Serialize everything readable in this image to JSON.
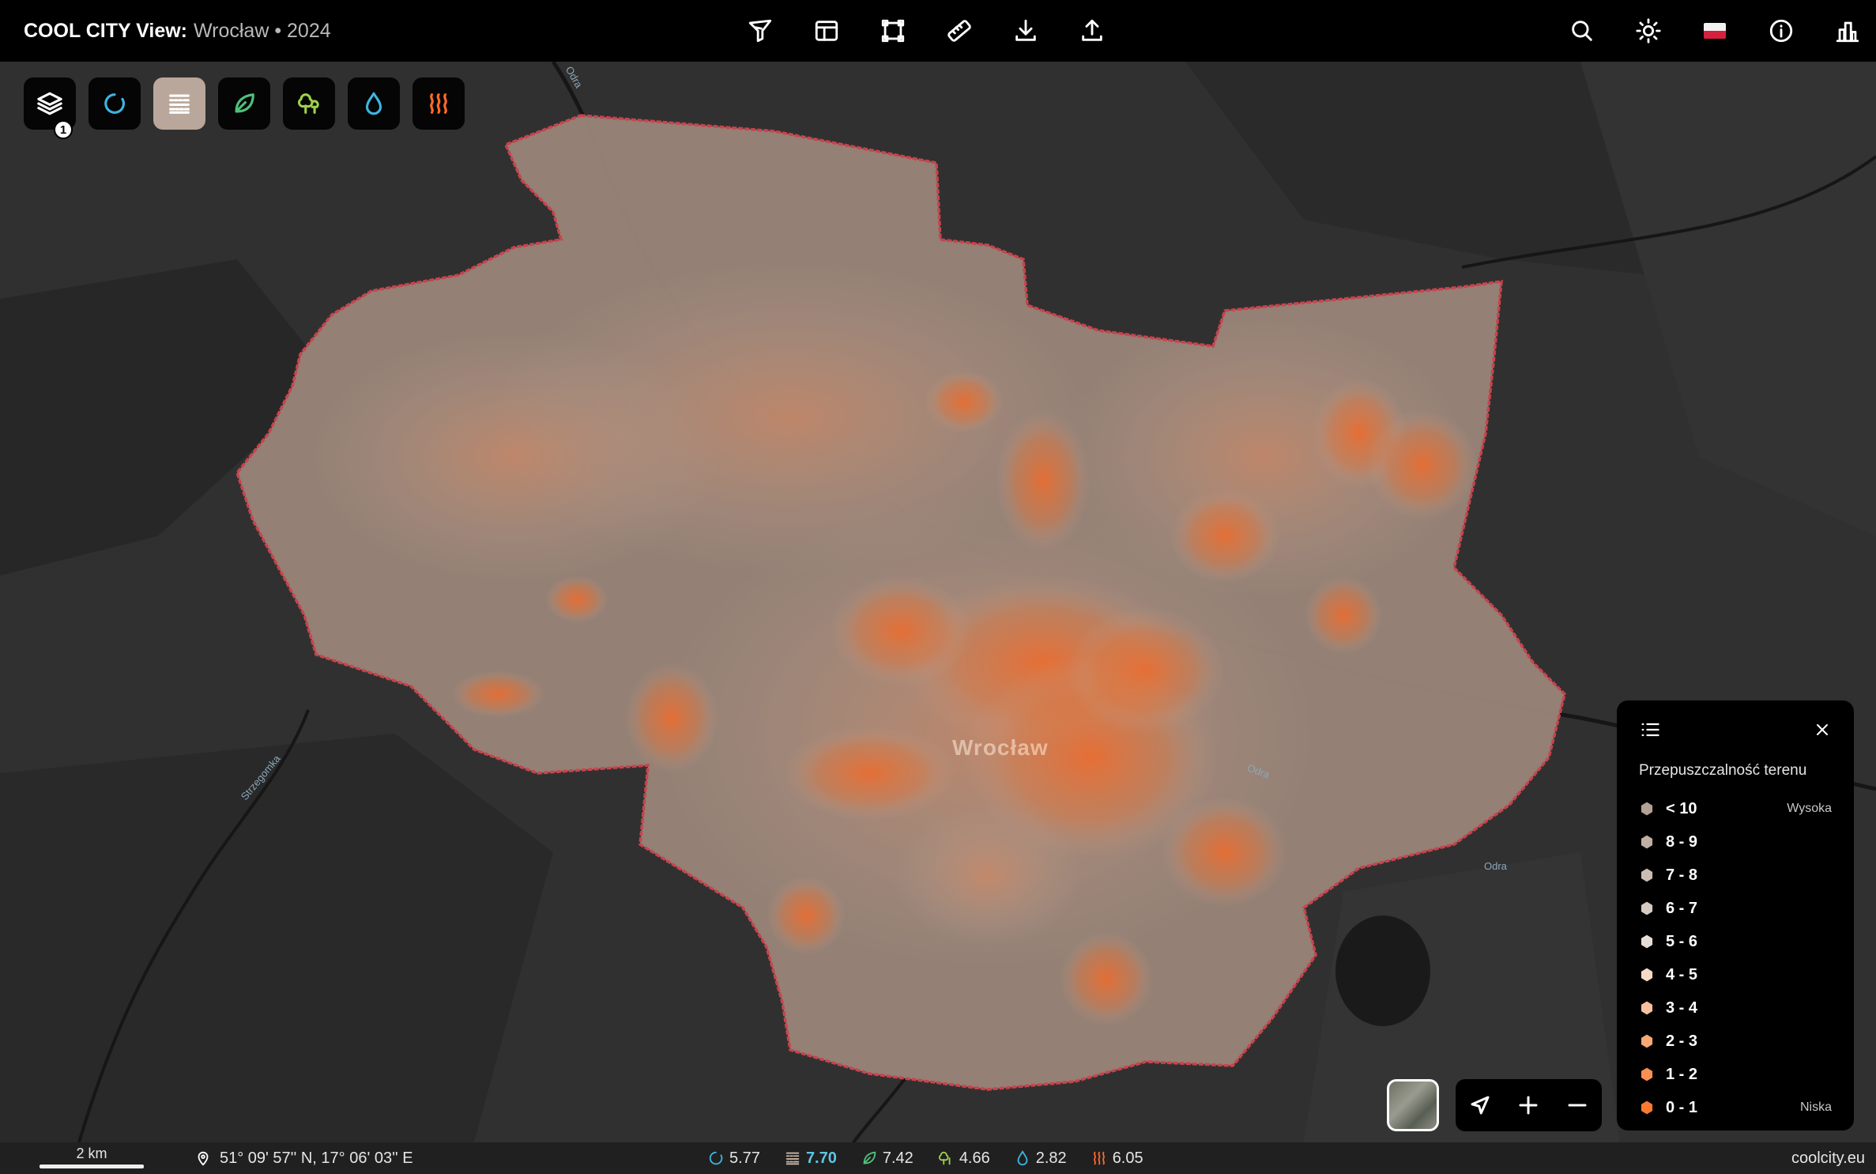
{
  "header": {
    "brand": "COOL CITY View:",
    "place": "Wrocław • 2024"
  },
  "toolbar_center": [
    {
      "name": "filter-icon"
    },
    {
      "name": "layout-icon"
    },
    {
      "name": "frame-select-icon"
    },
    {
      "name": "ruler-icon"
    },
    {
      "name": "download-icon"
    },
    {
      "name": "upload-icon"
    }
  ],
  "toolbar_right": [
    {
      "name": "search-icon"
    },
    {
      "name": "theme-sun-icon"
    },
    {
      "name": "flag-poland-icon"
    },
    {
      "name": "info-icon"
    },
    {
      "name": "buildings-icon"
    }
  ],
  "layers": {
    "badge": "1",
    "buttons": [
      {
        "name": "layers-icon",
        "color": "#ffffff",
        "active": false
      },
      {
        "name": "spinner-icon",
        "color": "#3cb6e0",
        "active": false
      },
      {
        "name": "permeability-icon",
        "color": "#ffffff",
        "active": true
      },
      {
        "name": "leaf-icon",
        "color": "#4ec27a",
        "active": false
      },
      {
        "name": "trees-icon",
        "color": "#9fd04a",
        "active": false
      },
      {
        "name": "water-drop-icon",
        "color": "#3cb6e0",
        "active": false
      },
      {
        "name": "heat-icon",
        "color": "#ff6a2a",
        "active": false
      }
    ]
  },
  "map": {
    "city_label": "Wrocław",
    "rivers": [
      "Odra",
      "Odra",
      "Odra",
      "Strzegomka"
    ],
    "boundary_color": "#c9434d",
    "fill_color": "#9a8578"
  },
  "legend": {
    "title": "Przepuszczalność terenu",
    "items": [
      {
        "label": "< 10",
        "side": "Wysoka",
        "color": "#b3a195"
      },
      {
        "label": "8 - 9",
        "side": "",
        "color": "#bfb0a5"
      },
      {
        "label": "7 - 8",
        "side": "",
        "color": "#cabdb3"
      },
      {
        "label": "6 - 7",
        "side": "",
        "color": "#d6cbc2"
      },
      {
        "label": "5 - 6",
        "side": "",
        "color": "#e6ddd6"
      },
      {
        "label": "4 - 5",
        "side": "",
        "color": "#f6d9c6"
      },
      {
        "label": "3 - 4",
        "side": "",
        "color": "#f7c09e"
      },
      {
        "label": "2 - 3",
        "side": "",
        "color": "#f8a776"
      },
      {
        "label": "1 - 2",
        "side": "",
        "color": "#f98f52"
      },
      {
        "label": "0 - 1",
        "side": "Niska",
        "color": "#fa7a31"
      }
    ]
  },
  "status": {
    "scale": "2 km",
    "coords": "51° 09' 57'' N, 17° 06' 03'' E",
    "metrics": [
      {
        "name": "spinner-metric-icon",
        "value": "5.77",
        "color": "#3cb6e0",
        "highlight": false
      },
      {
        "name": "permeability-metric-icon",
        "value": "7.70",
        "color": "#c9b6a8",
        "highlight": true
      },
      {
        "name": "leaf-metric-icon",
        "value": "7.42",
        "color": "#4ec27a",
        "highlight": false
      },
      {
        "name": "trees-metric-icon",
        "value": "4.66",
        "color": "#9fd04a",
        "highlight": false
      },
      {
        "name": "water-metric-icon",
        "value": "2.82",
        "color": "#3cb6e0",
        "highlight": false
      },
      {
        "name": "heat-metric-icon",
        "value": "6.05",
        "color": "#ff6a2a",
        "highlight": false
      }
    ],
    "site": "coolcity.eu"
  }
}
